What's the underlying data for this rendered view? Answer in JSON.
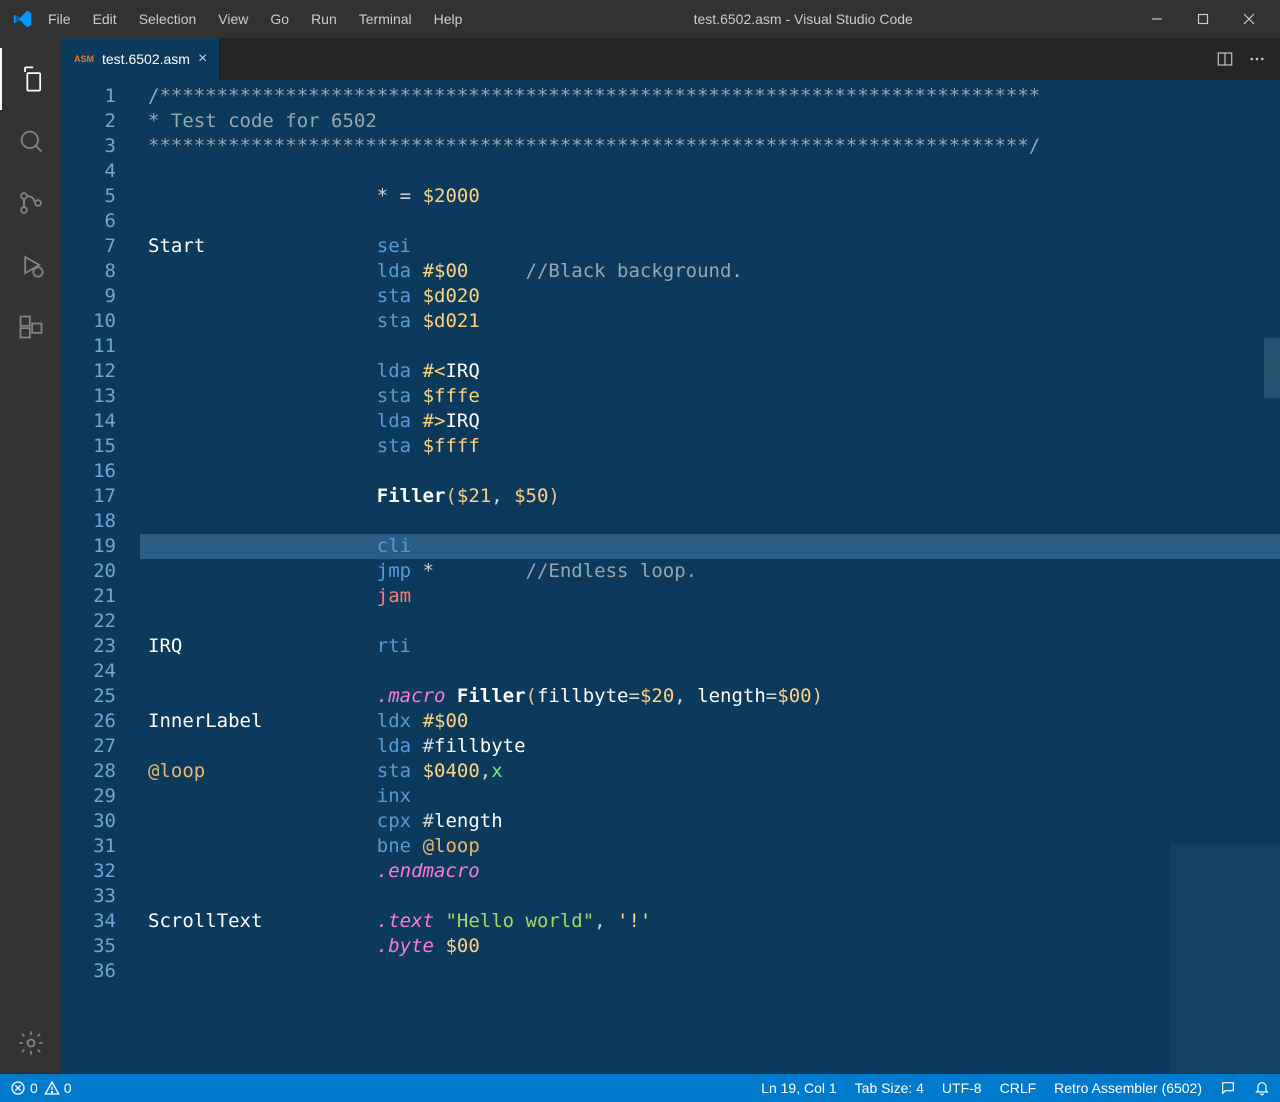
{
  "titlebar": {
    "menu": [
      "File",
      "Edit",
      "Selection",
      "View",
      "Go",
      "Run",
      "Terminal",
      "Help"
    ],
    "title": "test.6502.asm - Visual Studio Code"
  },
  "tab": {
    "lang_badge": "ASM",
    "filename": "test.6502.asm"
  },
  "gutter": {
    "start": 1,
    "end": 36
  },
  "code": {
    "lines": [
      [
        [
          "tk-comment",
          "/*****************************************************************************"
        ]
      ],
      [
        [
          "tk-comment",
          "* Test code for 6502"
        ]
      ],
      [
        [
          "tk-comment",
          "*****************************************************************************/"
        ]
      ],
      [],
      [
        [
          "",
          "                    "
        ],
        [
          "tk-star",
          "*"
        ],
        [
          "",
          " = "
        ],
        [
          "tk-number",
          "$2000"
        ]
      ],
      [],
      [
        [
          "tk-label",
          "Start"
        ],
        [
          "",
          "               "
        ],
        [
          "tk-mnemonic",
          "sei"
        ]
      ],
      [
        [
          "",
          "                    "
        ],
        [
          "tk-mnemonic",
          "lda"
        ],
        [
          "",
          " "
        ],
        [
          "tk-number",
          "#$00"
        ],
        [
          "",
          "     "
        ],
        [
          "tk-comment",
          "//Black background."
        ]
      ],
      [
        [
          "",
          "                    "
        ],
        [
          "tk-mnemonic",
          "sta"
        ],
        [
          "",
          " "
        ],
        [
          "tk-number",
          "$d020"
        ]
      ],
      [
        [
          "",
          "                    "
        ],
        [
          "tk-mnemonic",
          "sta"
        ],
        [
          "",
          " "
        ],
        [
          "tk-number",
          "$d021"
        ]
      ],
      [],
      [
        [
          "",
          "                    "
        ],
        [
          "tk-mnemonic",
          "lda"
        ],
        [
          "",
          " "
        ],
        [
          "tk-number",
          "#<"
        ],
        [
          "tk-ident",
          "IRQ"
        ]
      ],
      [
        [
          "",
          "                    "
        ],
        [
          "tk-mnemonic",
          "sta"
        ],
        [
          "",
          " "
        ],
        [
          "tk-number",
          "$fffe"
        ]
      ],
      [
        [
          "",
          "                    "
        ],
        [
          "tk-mnemonic",
          "lda"
        ],
        [
          "",
          " "
        ],
        [
          "tk-number",
          "#>"
        ],
        [
          "tk-ident",
          "IRQ"
        ]
      ],
      [
        [
          "",
          "                    "
        ],
        [
          "tk-mnemonic",
          "sta"
        ],
        [
          "",
          " "
        ],
        [
          "tk-number",
          "$ffff"
        ]
      ],
      [],
      [
        [
          "",
          "                    "
        ],
        [
          "tk-func",
          "Filler"
        ],
        [
          "tk-paren",
          "("
        ],
        [
          "tk-number",
          "$21"
        ],
        [
          "",
          ", "
        ],
        [
          "tk-number",
          "$50"
        ],
        [
          "tk-paren",
          ")"
        ]
      ],
      [],
      [
        [
          "",
          "                    "
        ],
        [
          "tk-mnemonic",
          "cli"
        ]
      ],
      [
        [
          "",
          "                    "
        ],
        [
          "tk-mnemonic",
          "jmp"
        ],
        [
          "",
          " "
        ],
        [
          "tk-star",
          "*"
        ],
        [
          "",
          "        "
        ],
        [
          "tk-comment",
          "//Endless loop."
        ]
      ],
      [
        [
          "",
          "                    "
        ],
        [
          "tk-jam",
          "jam"
        ]
      ],
      [],
      [
        [
          "tk-label",
          "IRQ"
        ],
        [
          "",
          "                 "
        ],
        [
          "tk-mnemonic",
          "rti"
        ]
      ],
      [],
      [
        [
          "",
          "                    "
        ],
        [
          "tk-directive",
          ".macro"
        ],
        [
          "",
          " "
        ],
        [
          "tk-func",
          "Filler"
        ],
        [
          "tk-paren",
          "("
        ],
        [
          "tk-ident",
          "fillbyte"
        ],
        [
          "",
          "="
        ],
        [
          "tk-number",
          "$20"
        ],
        [
          "",
          ", "
        ],
        [
          "tk-ident",
          "length"
        ],
        [
          "",
          "="
        ],
        [
          "tk-number",
          "$00"
        ],
        [
          "tk-paren",
          ")"
        ]
      ],
      [
        [
          "tk-label",
          "InnerLabel"
        ],
        [
          "",
          "          "
        ],
        [
          "tk-mnemonic",
          "ldx"
        ],
        [
          "",
          " "
        ],
        [
          "tk-number",
          "#$00"
        ]
      ],
      [
        [
          "",
          "                    "
        ],
        [
          "tk-mnemonic",
          "lda"
        ],
        [
          "",
          " #"
        ],
        [
          "tk-ident",
          "fillbyte"
        ]
      ],
      [
        [
          "tk-atloop",
          "@loop"
        ],
        [
          "",
          "               "
        ],
        [
          "tk-mnemonic",
          "sta"
        ],
        [
          "",
          " "
        ],
        [
          "tk-number",
          "$0400"
        ],
        [
          "",
          ","
        ],
        [
          "tk-x",
          "x"
        ]
      ],
      [
        [
          "",
          "                    "
        ],
        [
          "tk-mnemonic",
          "inx"
        ]
      ],
      [
        [
          "",
          "                    "
        ],
        [
          "tk-mnemonic",
          "cpx"
        ],
        [
          "",
          " #"
        ],
        [
          "tk-ident",
          "length"
        ]
      ],
      [
        [
          "",
          "                    "
        ],
        [
          "tk-mnemonic",
          "bne"
        ],
        [
          "",
          " "
        ],
        [
          "tk-atloop",
          "@loop"
        ]
      ],
      [
        [
          "",
          "                    "
        ],
        [
          "tk-directive",
          ".endmacro"
        ]
      ],
      [],
      [
        [
          "tk-label",
          "ScrollText"
        ],
        [
          "",
          "          "
        ],
        [
          "tk-directive",
          ".text"
        ],
        [
          "",
          " "
        ],
        [
          "tk-string",
          "\"Hello world\""
        ],
        [
          "",
          ", "
        ],
        [
          "tk-char",
          "'!'"
        ]
      ],
      [
        [
          "",
          "                    "
        ],
        [
          "tk-directive",
          ".byte"
        ],
        [
          "",
          " "
        ],
        [
          "tk-number",
          "$00"
        ]
      ],
      []
    ],
    "current_line": 19
  },
  "statusbar": {
    "errors": "0",
    "warnings": "0",
    "cursor": "Ln 19, Col 1",
    "tabsize": "Tab Size: 4",
    "encoding": "UTF-8",
    "eol": "CRLF",
    "mode": "Retro Assembler (6502)"
  }
}
